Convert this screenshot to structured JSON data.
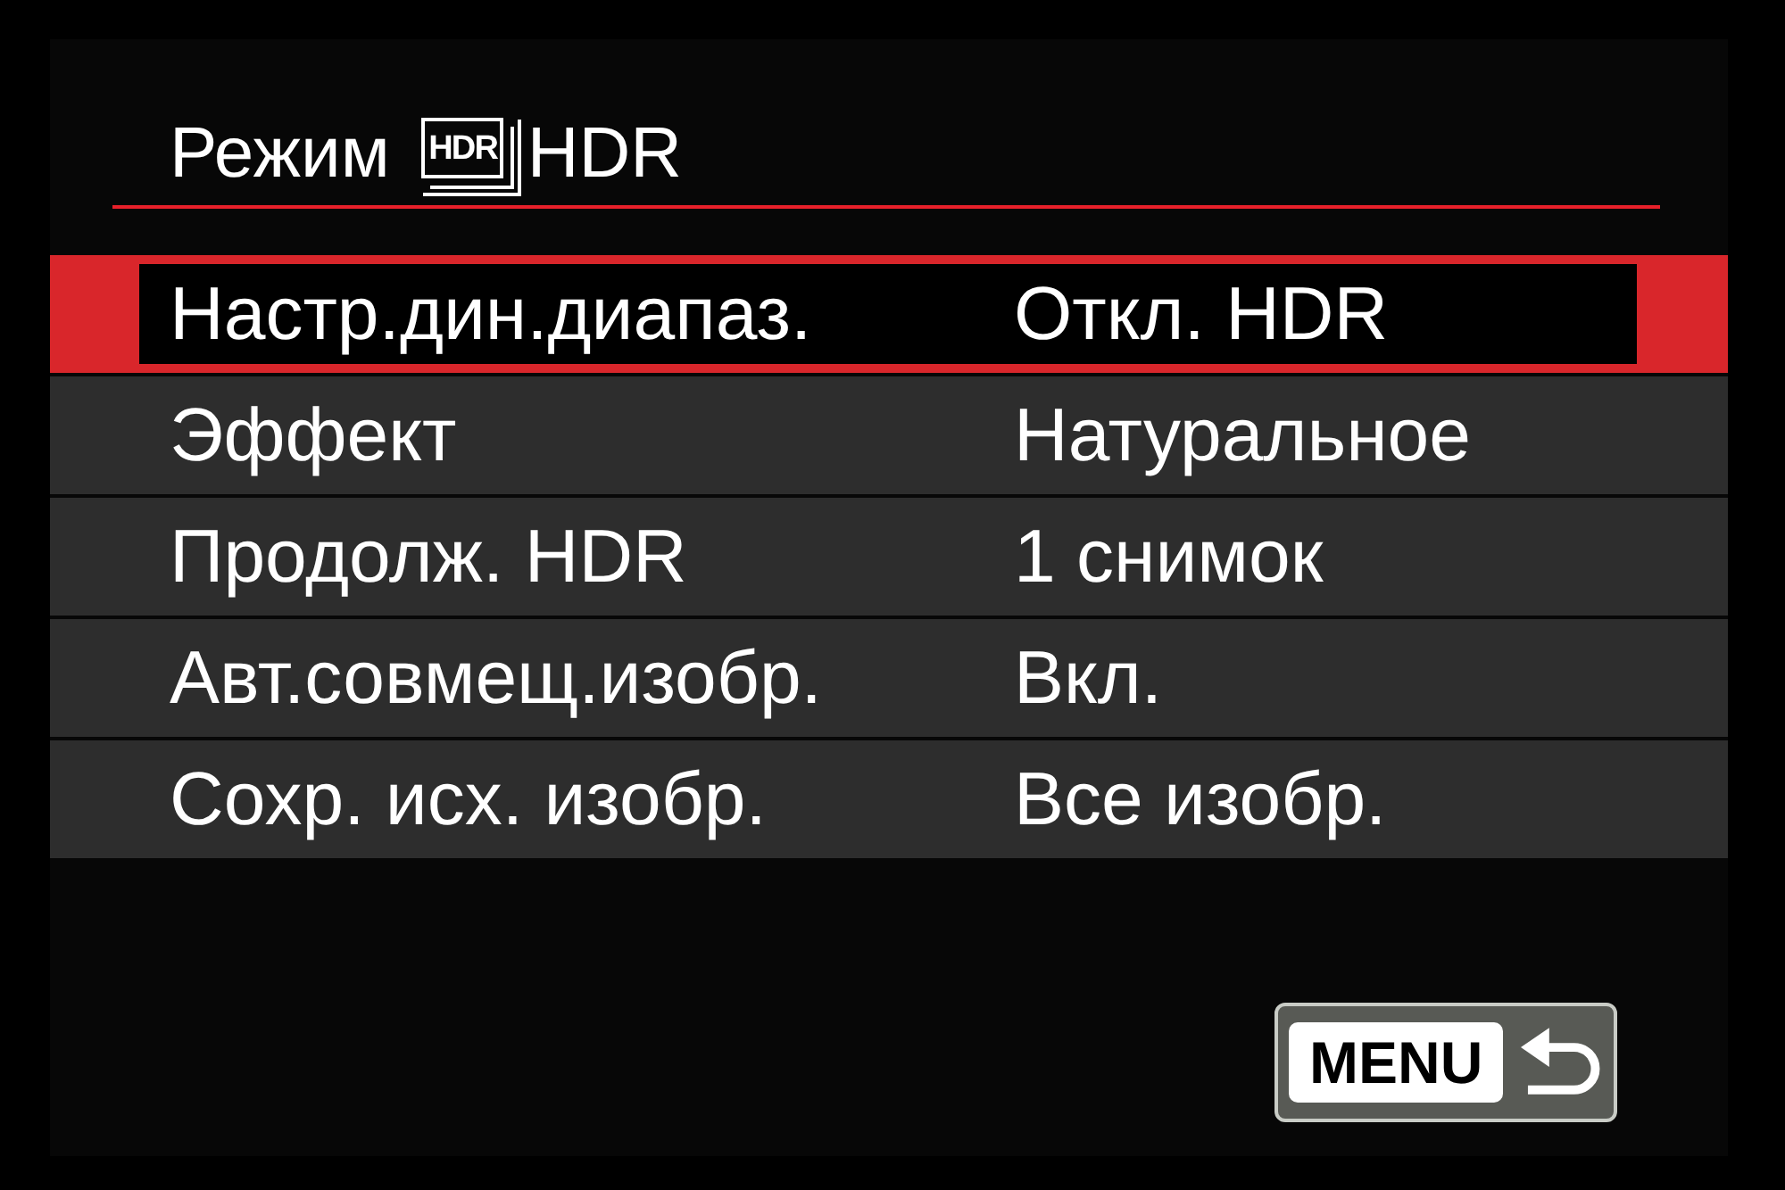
{
  "title": {
    "text": "Режим",
    "badge": "HDR",
    "suffix": "HDR"
  },
  "settings": [
    {
      "label": "Настр.дин.диапаз.",
      "value": "Откл. HDR",
      "selected": true
    },
    {
      "label": "Эффект",
      "value": "Натуральное",
      "selected": false
    },
    {
      "label": "Продолж. HDR",
      "value": "1 снимок",
      "selected": false
    },
    {
      "label": "Авт.совмещ.изобр.",
      "value": "Вкл.",
      "selected": false
    },
    {
      "label": "Сохр. исх. изобр.",
      "value": "Все изобр.",
      "selected": false
    }
  ],
  "back_button": {
    "key": "MENU"
  }
}
